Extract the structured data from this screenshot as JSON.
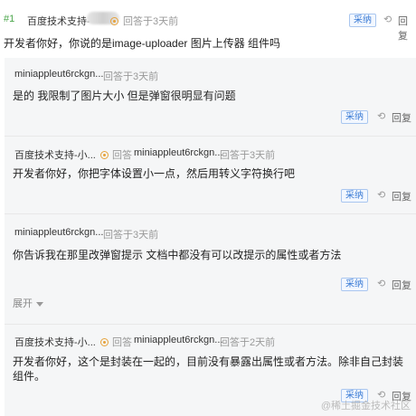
{
  "top": {
    "floor": "#1",
    "author": "百度技术支持-",
    "author_suffix": "~",
    "reply_word": "回答",
    "time": "回答于3天前",
    "adopt_label": "采纳",
    "reply_label": "回复",
    "content": "开发者你好，你说的是image-uploader 图片上传器 组件吗"
  },
  "replies": [
    {
      "author": "miniappleut6rckgn...",
      "time": "回答于3天前",
      "content": "是的  我限制了图片大小 但是弹窗很明显有问题",
      "adopt_label": "采纳",
      "reply_label": "回复"
    },
    {
      "author": "百度技术支持-小...",
      "reply_word": "回答",
      "target": "miniappleut6rckgn...",
      "time": "回答于3天前",
      "content": "开发者你好，你把字体设置小一点，然后用转义字符换行吧",
      "adopt_label": "采纳",
      "reply_label": "回复"
    },
    {
      "author": "miniappleut6rckgn...",
      "time": "回答于3天前",
      "content": "你告诉我在那里改弹窗提示  文档中都没有可以改提示的属性或者方法",
      "adopt_label": "采纳",
      "reply_label": "回复"
    },
    {
      "author": "百度技术支持-小...",
      "reply_word": "回答",
      "target": "miniappleut6rckgn...",
      "time": "回答于2天前",
      "content_line1": "开发者你好，这个是封装在一起的，目前没有暴露出属性或者方法。除非自己封装",
      "content_line2": "组件。",
      "adopt_label": "采纳",
      "reply_label": "回复"
    }
  ],
  "expand_label": "展开",
  "watermark": "@稀土掘金技术社区",
  "colors": {
    "accent": "#3a7bd5",
    "badge": "#e6a23c",
    "card_bg": "#f5f6f7"
  }
}
